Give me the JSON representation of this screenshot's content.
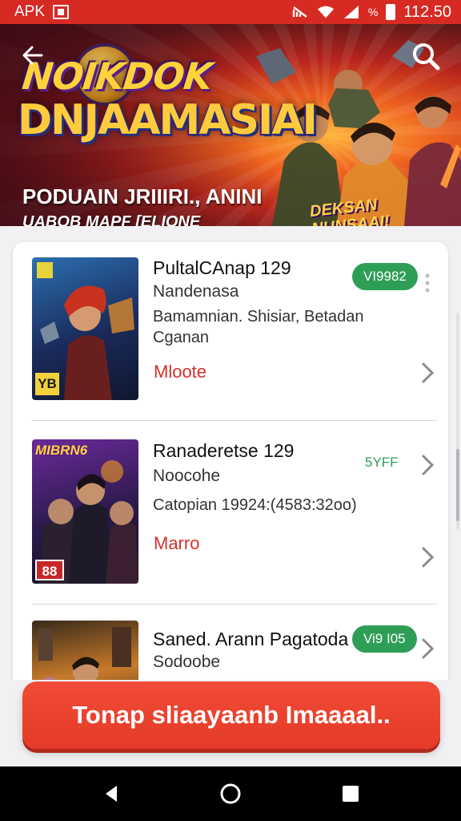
{
  "status_bar": {
    "label": "APK",
    "time": "112.50",
    "percent_icon": "%"
  },
  "hero": {
    "title_line1": "NOIKDOK",
    "title_line2": "DNJAAMASIAI",
    "subtitle1": "PODUAIN JRIIIRI., ANINI",
    "subtitle2": "UABOB MAPF [ELIONE",
    "badge_line1": "DEKSAN",
    "badge_line2": "NUNSAAI!"
  },
  "items": [
    {
      "title": "PultalCAnap 129",
      "subtitle": "Nandenasa",
      "desc_line1": "Bamamnian. Shisiar, Betadan",
      "desc_line2": "Cganan",
      "link": "Mloote",
      "version": "VI9982",
      "thumb_badge": "YB"
    },
    {
      "title": "Ranaderetse 129",
      "subtitle": "Noocohe",
      "desc_line1": "Catopian 19924:(4583:32oo)",
      "desc_line2": "",
      "link": "Marro",
      "version": "5YFF",
      "thumb_badge": "88",
      "thumb_title": "MIBRN6"
    },
    {
      "title": "Saned. Arann Pagatoda",
      "subtitle": "Sodoobe",
      "version": "Vi9 I05"
    }
  ],
  "cta": {
    "label": "Tonap sliaayaanb Imaaaal.."
  },
  "icons": {
    "back": "arrow-left-icon",
    "search": "search-icon",
    "chevron": "chevron-right-icon",
    "more": "more-vert-icon",
    "nav_back": "triangle-back-icon",
    "nav_home": "circle-home-icon",
    "nav_recents": "square-recents-icon"
  },
  "colors": {
    "accent": "#d72a23",
    "cta": "#e8412d",
    "green": "#2e9e57",
    "link": "#d4302a"
  }
}
